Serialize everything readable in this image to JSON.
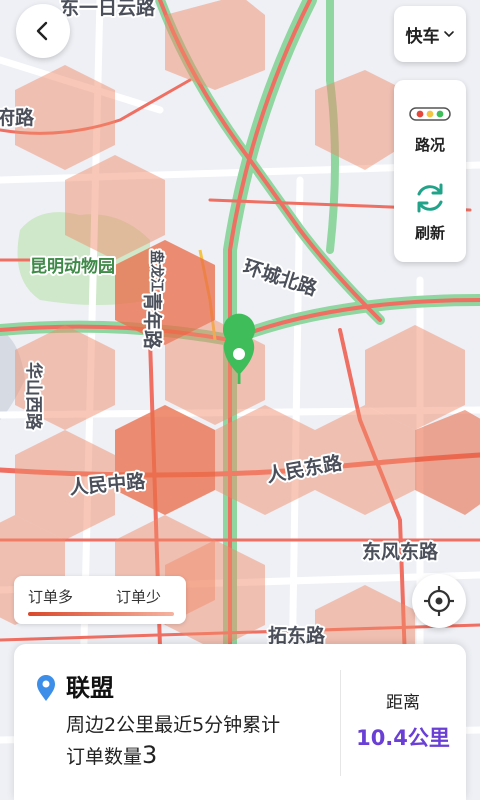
{
  "colors": {
    "heat": "#f08a68",
    "accent": "#6a3fd6",
    "pin": "#3fbd5a",
    "place_pin": "#3d8ee8"
  },
  "map": {
    "labels": [
      "东一日云路",
      "府路",
      "昆明动物园",
      "盘龙江",
      "青年路",
      "环城北路",
      "华山西路",
      "人民中路",
      "人民东路",
      "东风东路",
      "拓东路"
    ]
  },
  "header": {
    "back_icon": "chevron-left-icon",
    "mode_label": "快车"
  },
  "side_panel": {
    "traffic_label": "路况",
    "refresh_label": "刷新"
  },
  "legend": {
    "more_label": "订单多",
    "less_label": "订单少"
  },
  "info": {
    "place_icon": "location-pin-icon",
    "name": "联盟",
    "description_line1": "周边2公里最近5分钟累计",
    "description_line2": "订单数量",
    "order_count": "3",
    "distance_label": "距离",
    "distance_value": "10.4公里"
  }
}
